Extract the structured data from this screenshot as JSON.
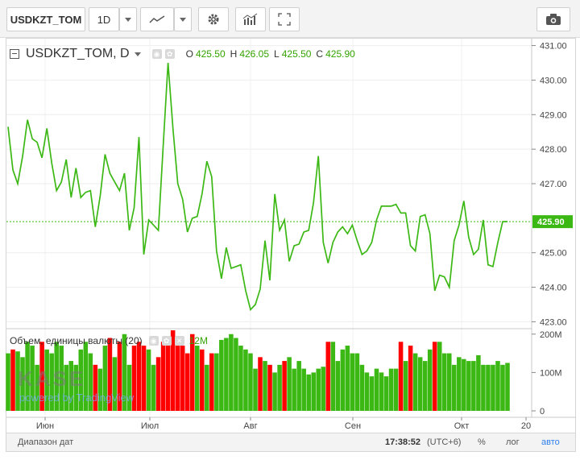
{
  "toolbar": {
    "symbol": "USDKZT_TOM",
    "interval": "1D"
  },
  "legend": {
    "title": "USDKZT_TOM, D",
    "o_label": "O",
    "o_value": "425.50",
    "h_label": "H",
    "h_value": "426.05",
    "l_label": "L",
    "l_value": "425.50",
    "c_label": "C",
    "c_value": "425.90"
  },
  "volume_legend": {
    "title": "Объем, единицы валюты (20)",
    "value": "12M"
  },
  "price_axis": {
    "ticks": [
      "431.00",
      "430.00",
      "429.00",
      "428.00",
      "427.00",
      "425.00",
      "424.00",
      "423.00"
    ],
    "current": "425.90"
  },
  "volume_axis": {
    "ticks": [
      "200M",
      "100M",
      "0"
    ]
  },
  "time_axis": {
    "labels": [
      "Июн",
      "Июл",
      "Авг",
      "Сен",
      "Окт",
      "20"
    ]
  },
  "watermark": {
    "brand": "KASE",
    "powered": "powered by TradingView"
  },
  "footer": {
    "range": "Диапазон дат",
    "time": "17:38:52",
    "tz": "(UTC+6)",
    "percent": "%",
    "log": "лог",
    "auto": "авто"
  },
  "colors": {
    "line": "#3cb815",
    "vol_up": "#3cb815",
    "vol_down": "#ff0000",
    "last_price_bg": "#3cb815"
  },
  "chart_data": {
    "type": "line",
    "price": [
      428.65,
      427.4,
      427.0,
      427.8,
      428.85,
      428.3,
      428.2,
      427.75,
      428.6,
      427.6,
      426.8,
      427.05,
      427.7,
      426.6,
      427.45,
      426.6,
      426.75,
      426.8,
      425.75,
      426.65,
      427.85,
      427.3,
      427.05,
      426.8,
      427.3,
      425.65,
      426.3,
      428.35,
      424.95,
      425.95,
      425.8,
      425.65,
      428.1,
      430.5,
      428.6,
      427.0,
      426.55,
      425.6,
      426.0,
      426.05,
      426.7,
      427.65,
      427.2,
      425.05,
      424.25,
      425.15,
      424.55,
      424.6,
      424.65,
      423.9,
      423.35,
      423.5,
      423.95,
      425.35,
      424.2,
      426.7,
      425.65,
      425.95,
      424.75,
      425.2,
      425.25,
      425.6,
      425.65,
      426.45,
      427.8,
      425.3,
      424.7,
      425.3,
      425.6,
      425.75,
      425.55,
      425.8,
      425.35,
      424.95,
      425.05,
      425.3,
      425.95,
      426.35,
      426.35,
      426.35,
      426.4,
      426.15,
      426.15,
      425.2,
      425.05,
      426.05,
      426.1,
      425.55,
      423.9,
      424.35,
      424.3,
      424.0,
      425.35,
      425.8,
      426.5,
      425.45,
      424.95,
      425.1,
      425.95,
      424.65,
      424.6,
      425.3,
      425.9,
      425.9
    ],
    "volume_M": [
      150,
      160,
      155,
      140,
      180,
      170,
      120,
      180,
      160,
      150,
      180,
      170,
      120,
      130,
      120,
      160,
      180,
      150,
      120,
      110,
      170,
      190,
      140,
      180,
      200,
      120,
      170,
      180,
      170,
      160,
      120,
      140,
      180,
      190,
      210,
      170,
      170,
      150,
      200,
      170,
      160,
      120,
      150,
      150,
      185,
      190,
      200,
      190,
      170,
      160,
      150,
      110,
      140,
      130,
      120,
      100,
      120,
      130,
      140,
      110,
      130,
      110,
      95,
      100,
      110,
      115,
      180,
      180,
      130,
      160,
      170,
      150,
      150,
      120,
      100,
      90,
      110,
      100,
      90,
      110,
      110,
      180,
      130,
      170,
      150,
      140,
      130,
      160,
      180,
      180,
      150,
      150,
      120,
      140,
      135,
      130,
      130,
      145,
      120,
      120,
      120,
      130,
      120,
      125
    ],
    "volume_down": [
      0,
      1,
      0,
      0,
      0,
      0,
      0,
      1,
      0,
      0,
      0,
      0,
      0,
      0,
      0,
      0,
      0,
      0,
      1,
      0,
      0,
      1,
      0,
      1,
      0,
      0,
      1,
      1,
      1,
      0,
      0,
      1,
      1,
      1,
      1,
      1,
      1,
      1,
      1,
      0,
      1,
      0,
      1,
      0,
      0,
      0,
      0,
      0,
      0,
      0,
      0,
      0,
      1,
      0,
      1,
      0,
      0,
      1,
      0,
      0,
      0,
      0,
      0,
      0,
      0,
      0,
      1,
      0,
      0,
      0,
      0,
      0,
      0,
      0,
      0,
      0,
      0,
      0,
      0,
      0,
      0,
      1,
      0,
      1,
      0,
      0,
      0,
      0,
      1,
      0,
      0,
      0,
      0,
      0,
      0,
      0,
      0,
      0,
      0,
      0,
      0,
      0,
      0,
      0
    ],
    "y_range": [
      422.8,
      431.2
    ],
    "volume_range_M": [
      0,
      210
    ]
  }
}
